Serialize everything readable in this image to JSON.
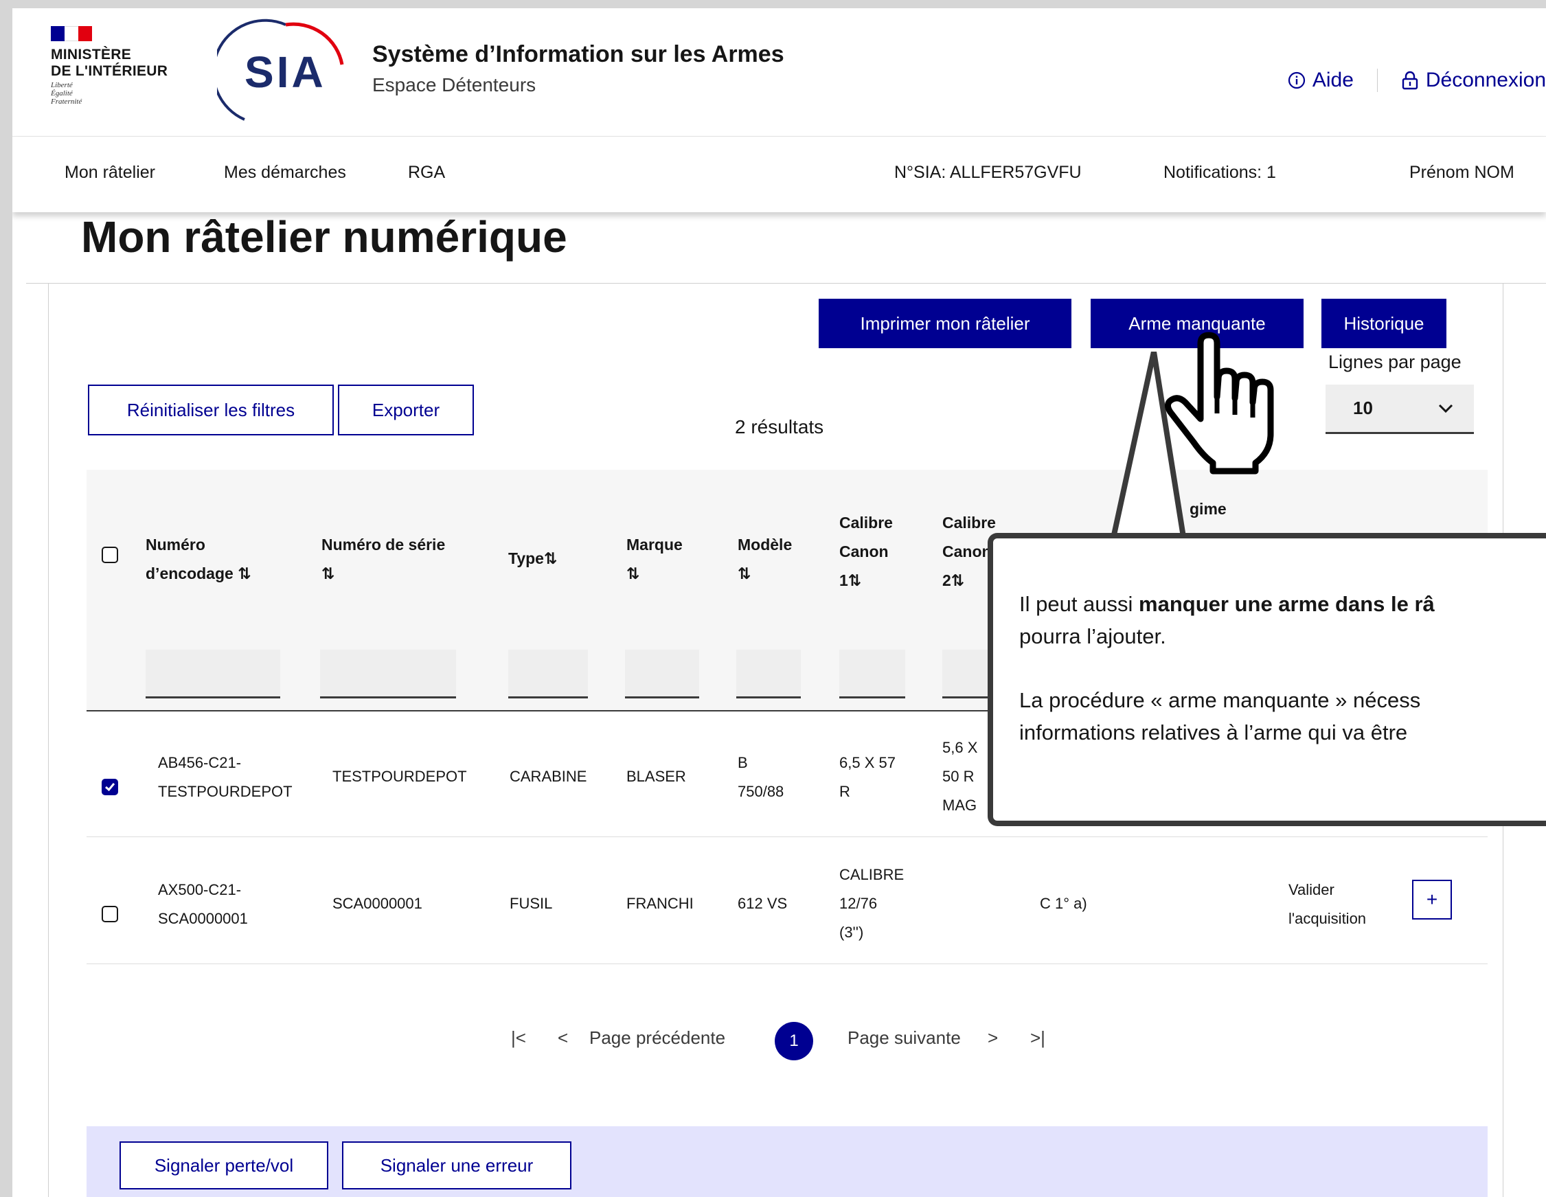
{
  "header": {
    "ministry_line1": "MINISTÈRE",
    "ministry_line2": "DE L'INTÉRIEUR",
    "motto_1": "Liberté",
    "motto_2": "Égalité",
    "motto_3": "Fraternité",
    "logo_text": "SIA",
    "title": "Système d’Information sur les Armes",
    "subtitle": "Espace Détenteurs",
    "help_label": "Aide",
    "logout_label": "Déconnexion"
  },
  "nav": {
    "items": [
      "Mon râtelier",
      "Mes démarches",
      "RGA"
    ],
    "sia_number": "N°SIA: ALLFER57GVFU",
    "notifications": "Notifications: 1",
    "user": "Prénom NOM"
  },
  "page_title": "Mon râtelier numérique",
  "actions": {
    "print": "Imprimer mon râtelier",
    "missing": "Arme manquante",
    "history": "Historique",
    "reset_filters": "Réinitialiser les filtres",
    "export": "Exporter"
  },
  "rows_per_page": {
    "label": "Lignes par page",
    "value": "10"
  },
  "results": "2 résultats",
  "table": {
    "headers": {
      "encoding_1": "Numéro",
      "encoding_2": "d’encodage ⇅",
      "serial_1": "Numéro de série",
      "serial_2": "⇅",
      "type": "Type⇅",
      "brand_1": "Marque",
      "brand_2": "⇅",
      "model_1": "Modèle",
      "model_2": "⇅",
      "cal1_1": "Calibre",
      "cal1_2": "Canon",
      "cal1_3": "1⇅",
      "cal2_1": "Calibre",
      "cal2_2": "Canon",
      "cal2_3": "2⇅",
      "regime_partial": "gime"
    },
    "rows": [
      {
        "checked": true,
        "encoding_1": "AB456-C21-",
        "encoding_2": "TESTPOURDEPOT",
        "serial": "TESTPOURDEPOT",
        "type": "CARABINE",
        "brand": "BLASER",
        "model_1": "B",
        "model_2": "750/88",
        "cal1_1": "6,5 X 57",
        "cal1_2": "R",
        "cal2_1": "5,6 X",
        "cal2_2": "50 R",
        "cal2_3": "MAG"
      },
      {
        "checked": false,
        "encoding_1": "AX500-C21-",
        "encoding_2": "SCA0000001",
        "serial": "SCA0000001",
        "type": "FUSIL",
        "brand": "FRANCHI",
        "model": "612 VS",
        "cal1_1": "CALIBRE",
        "cal1_2": "12/76",
        "cal1_3": "(3'')",
        "category": "C 1° a)",
        "action_1": "Valider",
        "action_2": "l'acquisition",
        "plus": "+"
      }
    ]
  },
  "pagination": {
    "first": "|<",
    "prev_arrow": "<",
    "prev": "Page précédente",
    "current": "1",
    "next": "Page suivante",
    "next_arrow": ">",
    "last": ">|"
  },
  "bottom_actions": {
    "loss": "Signaler perte/vol",
    "error": "Signaler une erreur"
  },
  "tooltip": {
    "p1_a": "Il peut aussi ",
    "p1_b": "manquer une arme dans le râ",
    "p1_c": "pourra l’ajouter.",
    "p2_a": "La procédure « arme manquante » nécess",
    "p2_b": "informations relatives à l’arme qui va être"
  },
  "colors": {
    "primary": "#000091",
    "flag_blue": "#000091",
    "flag_red": "#e1000f",
    "logo_red": "#e1000f",
    "tooltip_border": "#3a3a3a",
    "bottom_bar": "#e3e3fd"
  }
}
